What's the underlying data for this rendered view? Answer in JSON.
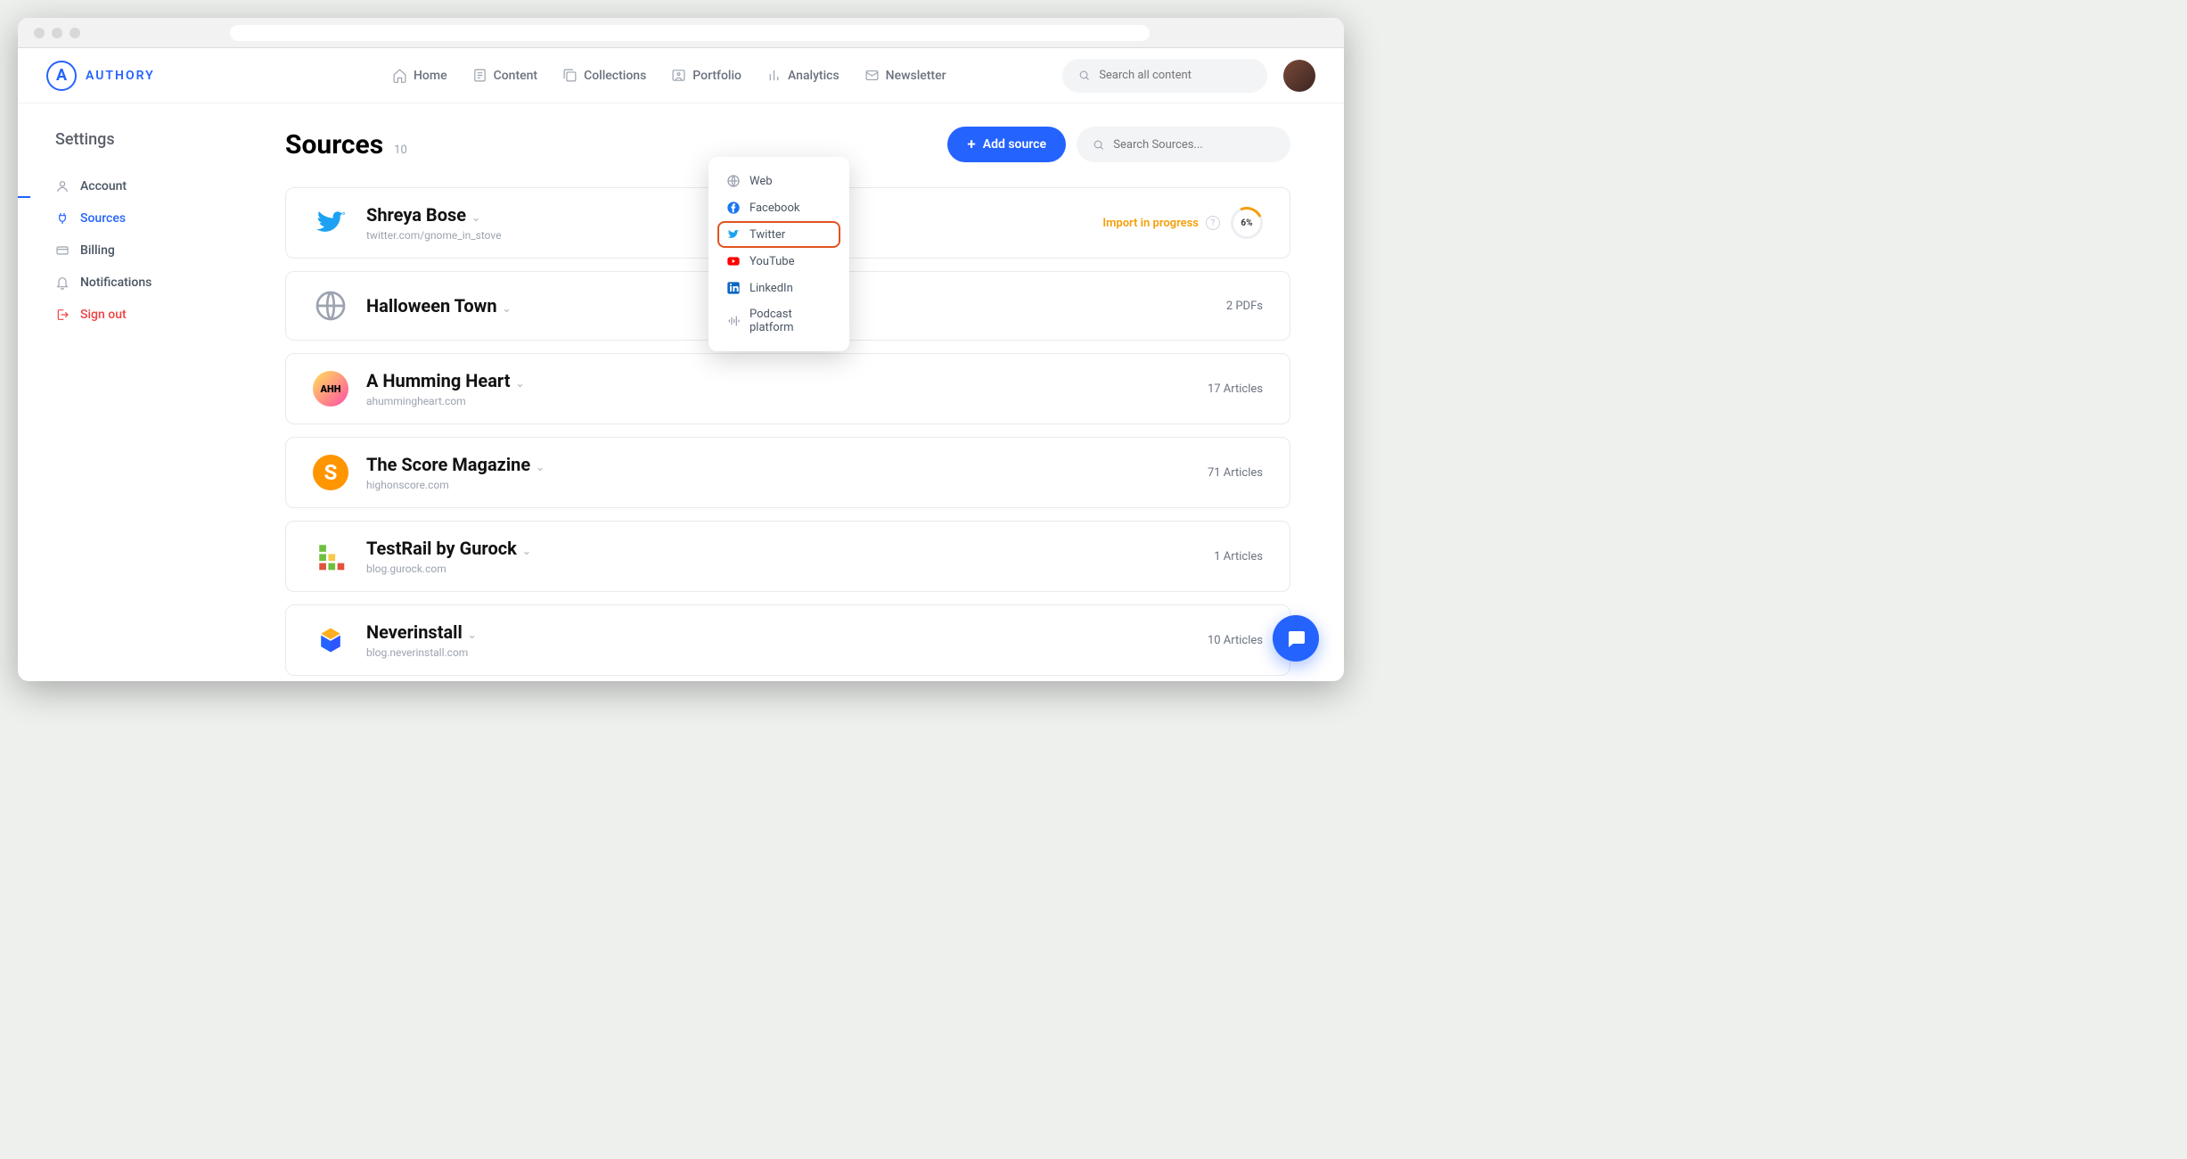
{
  "brand": "AUTHORY",
  "topnav": [
    {
      "label": "Home"
    },
    {
      "label": "Content"
    },
    {
      "label": "Collections"
    },
    {
      "label": "Portfolio"
    },
    {
      "label": "Analytics"
    },
    {
      "label": "Newsletter"
    }
  ],
  "search_top_placeholder": "Search all content",
  "sidebar": {
    "title": "Settings",
    "items": [
      {
        "label": "Account"
      },
      {
        "label": "Sources"
      },
      {
        "label": "Billing"
      },
      {
        "label": "Notifications"
      },
      {
        "label": "Sign out"
      }
    ]
  },
  "header": {
    "title": "Sources",
    "count": "10",
    "add_label": "Add source",
    "search_placeholder": "Search Sources..."
  },
  "dropdown": [
    {
      "label": "Web"
    },
    {
      "label": "Facebook"
    },
    {
      "label": "Twitter"
    },
    {
      "label": "YouTube"
    },
    {
      "label": "LinkedIn"
    },
    {
      "label": "Podcast platform"
    }
  ],
  "sources": [
    {
      "title": "Shreya Bose",
      "sub": "twitter.com/gnome_in_stove",
      "status": "Import in progress",
      "progress": "6%"
    },
    {
      "title": "Halloween Town",
      "sub": "",
      "meta": "2 PDFs"
    },
    {
      "title": "A Humming Heart",
      "sub": "ahummingheart.com",
      "meta": "17 Articles"
    },
    {
      "title": "The Score Magazine",
      "sub": "highonscore.com",
      "meta": "71 Articles"
    },
    {
      "title": "TestRail by Gurock",
      "sub": "blog.gurock.com",
      "meta": "1 Articles"
    },
    {
      "title": "Neverinstall",
      "sub": "blog.neverinstall.com",
      "meta": "10 Articles"
    }
  ]
}
